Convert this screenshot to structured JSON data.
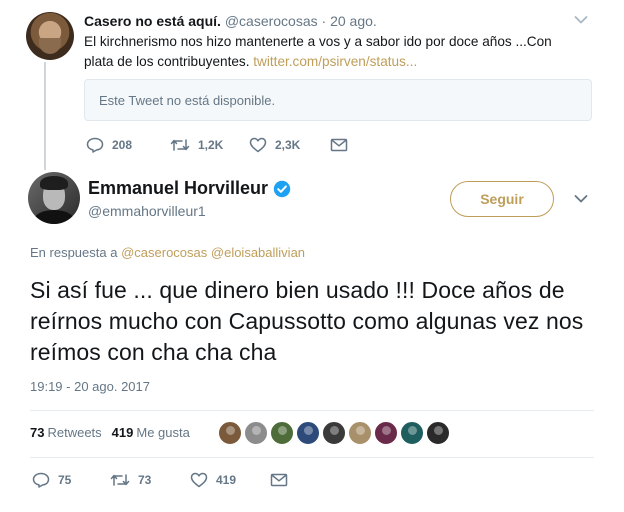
{
  "parent_tweet": {
    "name": "Casero no está aquí.",
    "handle": "@caserocosas",
    "separator": "·",
    "date": "20 ago.",
    "text": "El kirchnerismo nos hizo mantenerte a vos y a sabor ido por doce años ...Con plata de los contribuyentes.",
    "link": "twitter.com/psirven/status...",
    "quoted_unavailable": "Este Tweet no está disponible.",
    "replies": "208",
    "retweets": "1,2K",
    "likes": "2,3K"
  },
  "main_tweet": {
    "name": "Emmanuel Horvilleur",
    "handle": "@emmahorvilleur1",
    "follow_label": "Seguir",
    "reply_prefix": "En respuesta a",
    "reply_user_1": "@caserocosas",
    "reply_user_2": "@eloisaballivian",
    "text": "Si así fue ... que dinero bien usado !!! Doce años de reírnos mucho con Capussotto como algunas vez nos reímos con cha cha cha",
    "timestamp": "19:19 - 20 ago. 2017",
    "retweet_count": "73",
    "retweet_label": "Retweets",
    "like_count": "419",
    "like_label": "Me gusta",
    "action_replies": "75",
    "action_retweets": "73",
    "action_likes": "419"
  },
  "liker_colors": [
    "#7a5a3a",
    "#8c8c8c",
    "#4e6b3a",
    "#2e4a7a",
    "#3a3a3a",
    "#a8906a",
    "#6a2a4a",
    "#1f5e5e",
    "#2a2a2a"
  ],
  "colors": {
    "accent": "#bf9e5a",
    "verified": "#1da1f2",
    "muted_text": "#657786",
    "icon": "#657786"
  }
}
